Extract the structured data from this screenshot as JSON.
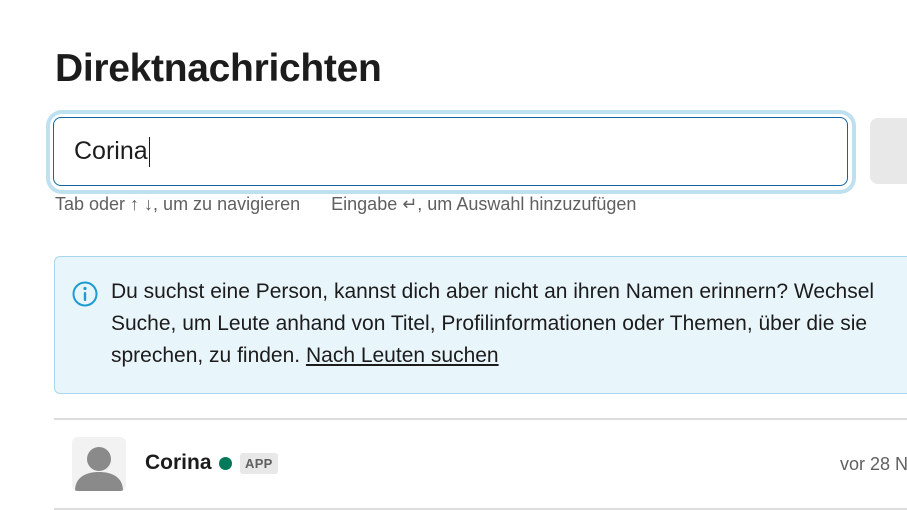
{
  "page": {
    "title": "Direktnachrichten"
  },
  "search": {
    "value": "Corina"
  },
  "hints": {
    "navigate": "Tab oder ↑ ↓, um zu navigieren",
    "add": "Eingabe ↵, um Auswahl hinzuzufügen"
  },
  "info": {
    "icon": "info-icon",
    "line1": "Du suchst eine Person, kannst dich aber nicht an ihren Namen erinnern? Wechsel",
    "line2": "Suche, um Leute anhand von Titel, Profilinformationen oder Themen, über die sie",
    "line3_text": "sprechen, zu finden. ",
    "line3_link": "Nach Leuten suchen"
  },
  "results": [
    {
      "name": "Corina",
      "badge": "APP",
      "time": "vor 28 N",
      "presence": "active",
      "presence_color": "#007a5a"
    }
  ],
  "colors": {
    "accent": "#1264a3",
    "info_bg": "#e8f5fa",
    "info_icon": "#1d9bd1"
  }
}
